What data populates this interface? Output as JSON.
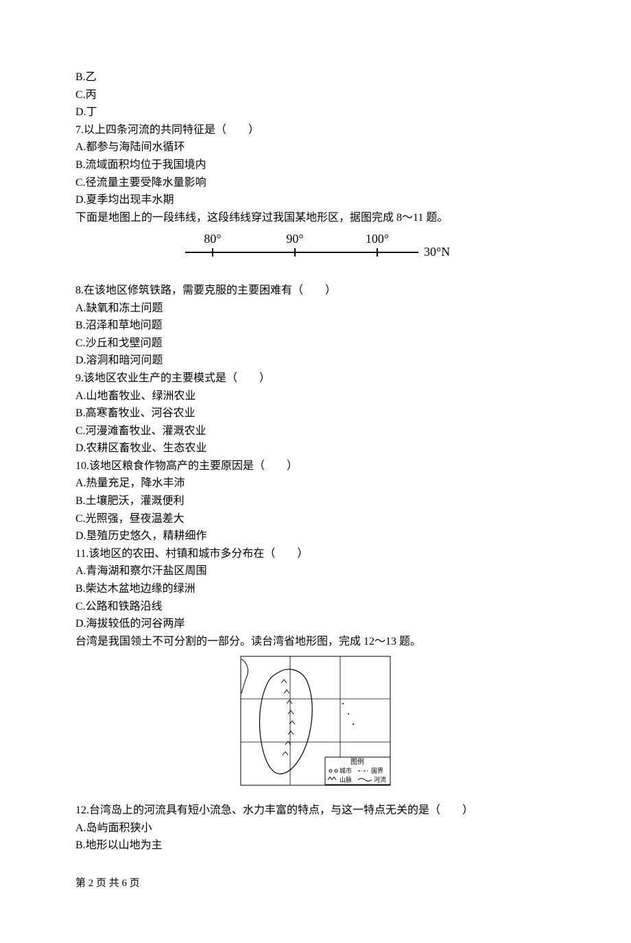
{
  "optionsTop": {
    "b": "B.乙",
    "c": "C.丙",
    "d": "D.丁"
  },
  "q7": {
    "stem": "7.以上四条河流的共同特征是（　　）",
    "a": "A.都参与海陆间水循环",
    "b": "B.流域面积均位于我国境内",
    "c": "C.径流量主要受降水量影响",
    "d": "D.夏季均出现丰水期"
  },
  "lead8": "下面是地图上的一段纬线，这段纬线穿过我国某地形区，据图完成 8～11 题。",
  "latDiagram": {
    "ticks": [
      "80°",
      "90°",
      "100°"
    ],
    "lat": "30°N"
  },
  "q8": {
    "stem": "8.在该地区修筑铁路，需要克服的主要困难有（　　）",
    "a": "A.缺氧和冻土问题",
    "b": "B.沼泽和草地问题",
    "c": "C.沙丘和戈壁问题",
    "d": "D.溶洞和暗河问题"
  },
  "q9": {
    "stem": "9.该地区农业生产的主要模式是（　　）",
    "a": "A.山地畜牧业、绿洲农业",
    "b": "B.高寒畜牧业、河谷农业",
    "c": "C.河漫滩畜牧业、灌溉农业",
    "d": "D.农耕区畜牧业、生态农业"
  },
  "q10": {
    "stem": "10.该地区粮食作物高产的主要原因是（　　）",
    "a": "A.热量充足，降水丰沛",
    "b": "B.土壤肥沃，灌溉便利",
    "c": "C.光照强，昼夜温差大",
    "d": "D.垦殖历史悠久，精耕细作"
  },
  "q11": {
    "stem": "11.该地区的农田、村镇和城市多分布在（　　）",
    "a": "A.青海湖和察尔汗盐区周围",
    "b": "B.柴达木盆地边缘的绿洲",
    "c": "C.公路和铁路沿线",
    "d": "D.海拔较低的河谷两岸"
  },
  "lead12": "台湾是我国领土不可分割的一部分。读台湾省地形图，完成 12～13 题。",
  "taiwanLegend": {
    "title": "图例",
    "city": "城市",
    "border": "国界",
    "mountain": "山脉",
    "river": "河流"
  },
  "q12": {
    "stem": "12.台湾岛上的河流具有短小流急、水力丰富的特点，与这一特点无关的是（　　）",
    "a": "A.岛屿面积狭小",
    "b": "B.地形以山地为主"
  },
  "footer": "第 2 页 共 6 页"
}
